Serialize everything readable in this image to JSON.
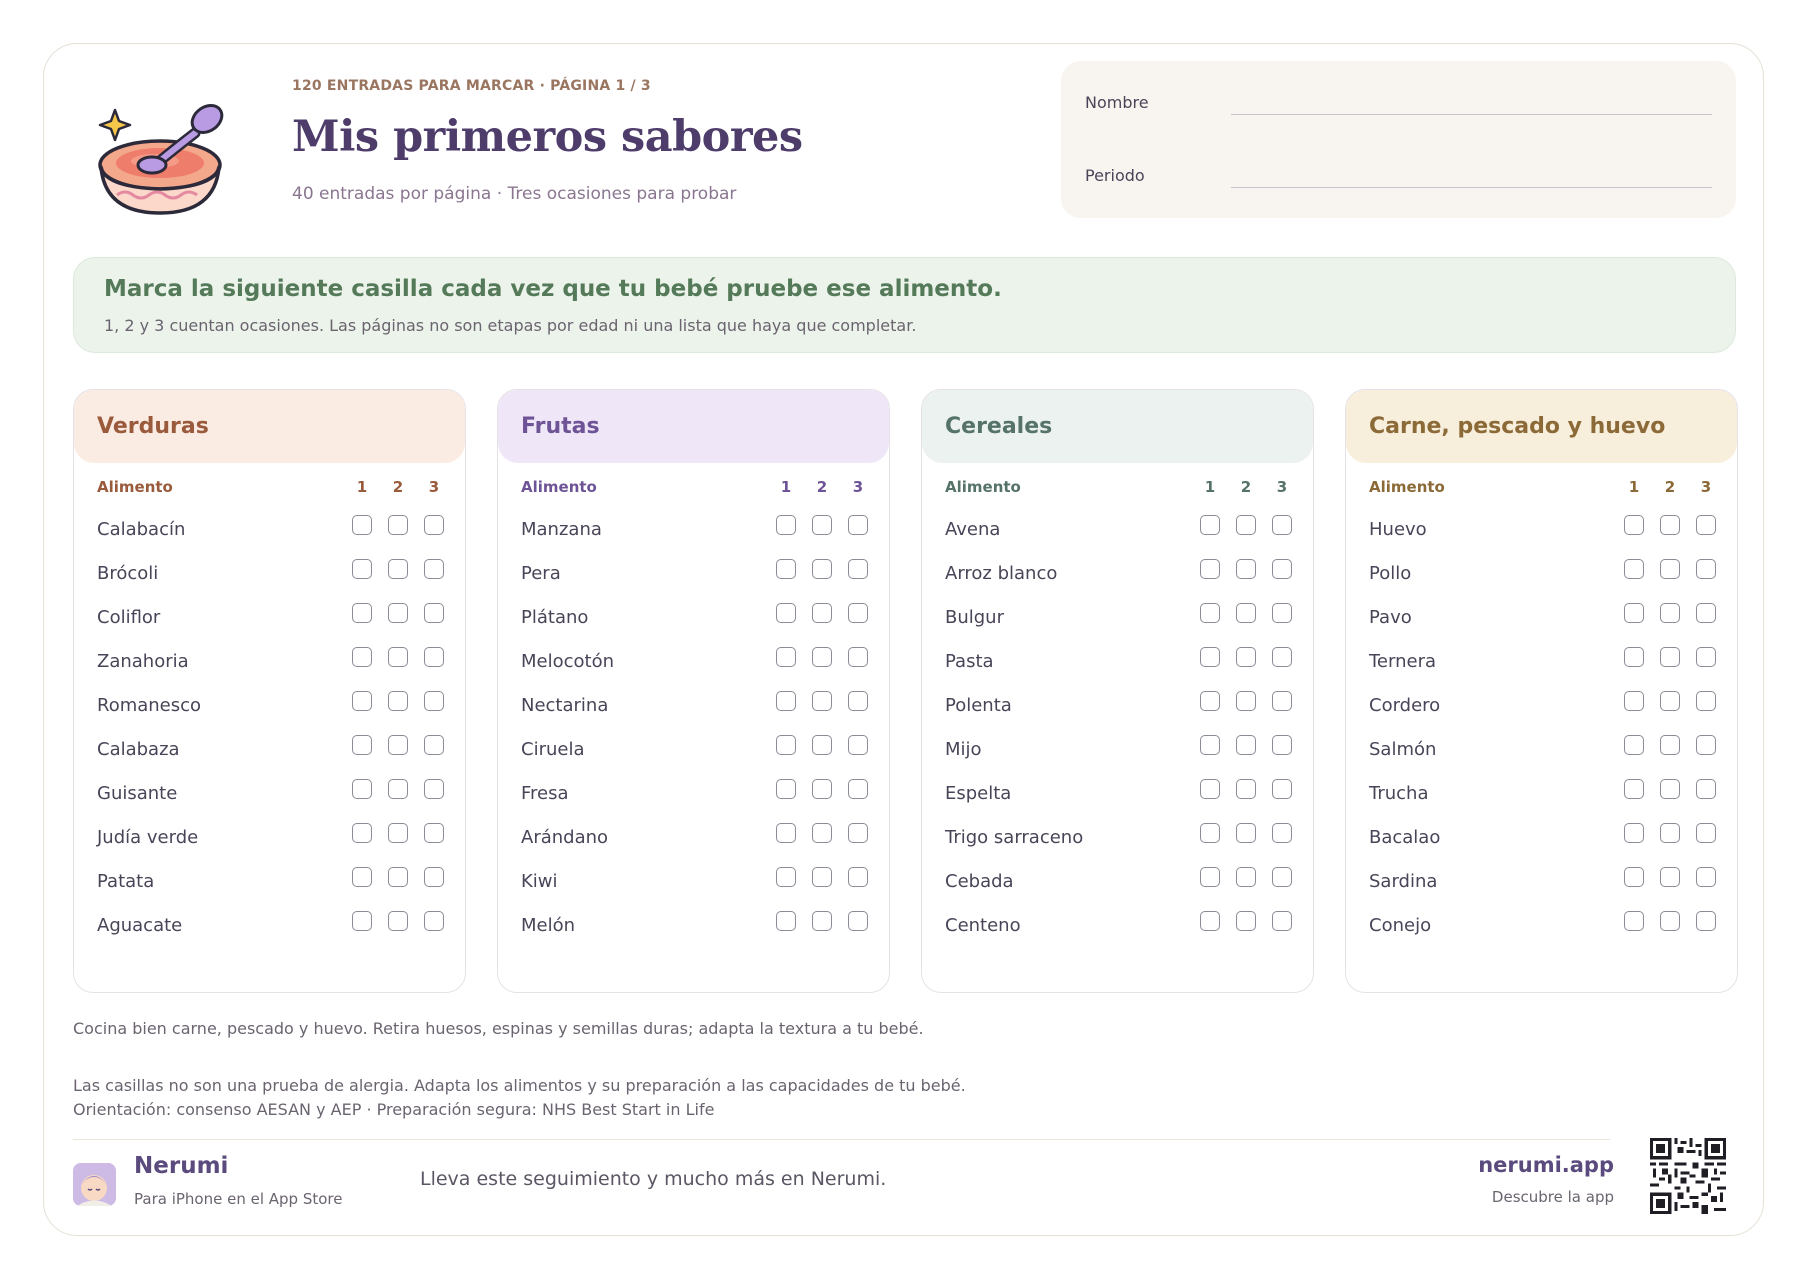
{
  "header": {
    "overline": "120 ENTRADAS PARA MARCAR · PÁGINA 1 / 3",
    "title": "Mis primeros sabores",
    "subtitle": "40 entradas por página · Tres ocasiones para probar",
    "icon": "baby-food-bowl-icon"
  },
  "form": {
    "name_label": "Nombre",
    "period_label": "Periodo"
  },
  "banner": {
    "title": "Marca la siguiente casilla cada vez que tu bebé pruebe ese alimento.",
    "subtitle": "1, 2 y 3 cuentan ocasiones. Las páginas no son etapas por edad ni una lista que haya que completar."
  },
  "table_headers": {
    "food": "Alimento",
    "n1": "1",
    "n2": "2",
    "n3": "3"
  },
  "categories": [
    {
      "title": "Verduras",
      "head_bg": "#fbece3",
      "accent": "#9a5a3c",
      "items": [
        "Calabacín",
        "Brócoli",
        "Coliflor",
        "Zanahoria",
        "Romanesco",
        "Calabaza",
        "Guisante",
        "Judía verde",
        "Patata",
        "Aguacate"
      ]
    },
    {
      "title": "Frutas",
      "head_bg": "#efe7f8",
      "accent": "#6e5496",
      "items": [
        "Manzana",
        "Pera",
        "Plátano",
        "Melocotón",
        "Nectarina",
        "Ciruela",
        "Fresa",
        "Arándano",
        "Kiwi",
        "Melón"
      ]
    },
    {
      "title": "Cereales",
      "head_bg": "#ecf2ef",
      "accent": "#567369",
      "items": [
        "Avena",
        "Arroz blanco",
        "Bulgur",
        "Pasta",
        "Polenta",
        "Mijo",
        "Espelta",
        "Trigo sarraceno",
        "Cebada",
        "Centeno"
      ]
    },
    {
      "title": "Carne, pescado y huevo",
      "head_bg": "#f8eedc",
      "accent": "#8b6a38",
      "items": [
        "Huevo",
        "Pollo",
        "Pavo",
        "Ternera",
        "Cordero",
        "Salmón",
        "Trucha",
        "Bacalao",
        "Sardina",
        "Conejo"
      ]
    }
  ],
  "notes": {
    "safety": "Cocina bien carne, pescado y huevo. Retira huesos, espinas y semillas duras; adapta la textura a tu bebé.",
    "allergy": "Las casillas no son una prueba de alergia. Adapta los alimentos y su preparación a las capacidades de tu bebé.",
    "sources": "Orientación: consenso AESAN y AEP · Preparación segura: NHS Best Start in Life"
  },
  "footer": {
    "brand": "Nerumi",
    "brand_sub": "Para iPhone en el App Store",
    "promo": "Lleva este seguimiento y mucho más en Nerumi.",
    "site": "nerumi.app",
    "site_sub": "Descubre la app",
    "logo_icon": "sleeping-baby-icon",
    "qr_icon": "qr-code-icon"
  }
}
